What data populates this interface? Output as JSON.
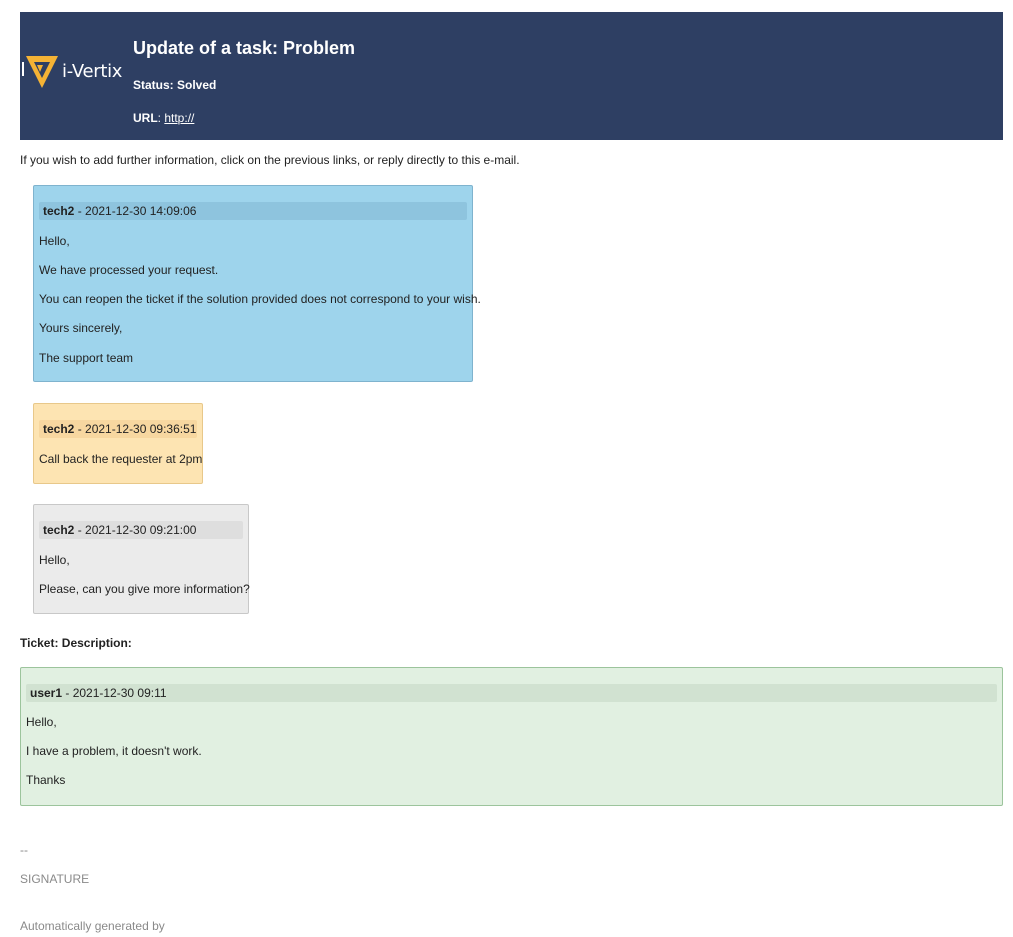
{
  "header": {
    "logo_text": "i-Vertix",
    "title": "Update of a task: Problem",
    "status": "Status: Solved",
    "url_label": "URL",
    "url_sep": ": ",
    "url_link": "http://"
  },
  "intro": "If you wish to add further information, click on the previous links, or reply directly to this e-mail.",
  "followups": [
    {
      "author": "tech2",
      "date": " - 2021-12-30 14:09:06",
      "lines": [
        "Hello,",
        "We have processed your request.",
        "You can reopen the ticket if the solution provided does not correspond to your wish.",
        "Yours sincerely,",
        "The support team"
      ]
    },
    {
      "author": "tech2",
      "date": " - 2021-12-30 09:36:51",
      "lines": [
        "Call back the requester at 2pm"
      ]
    },
    {
      "author": "tech2",
      "date": " - 2021-12-30 09:21:00",
      "lines": [
        "Hello,",
        "Please, can you give more information?"
      ]
    }
  ],
  "description": {
    "title": "Ticket: Description:",
    "author": "user1",
    "date": " - 2021-12-30 09:11",
    "lines": [
      "Hello,",
      "I have a problem, it doesn't work.",
      "Thanks"
    ]
  },
  "footer": {
    "separator": "--",
    "signature": "SIGNATURE",
    "generated": "Automatically generated by"
  },
  "colors": {
    "header_bg": "#2e3f63",
    "logo_accent": "#f5b335",
    "followup_blue": "#9ed4ec",
    "task_yellow": "#fde4b2",
    "followup_gray": "#ebebeb",
    "description_green": "#e1f0e1"
  }
}
